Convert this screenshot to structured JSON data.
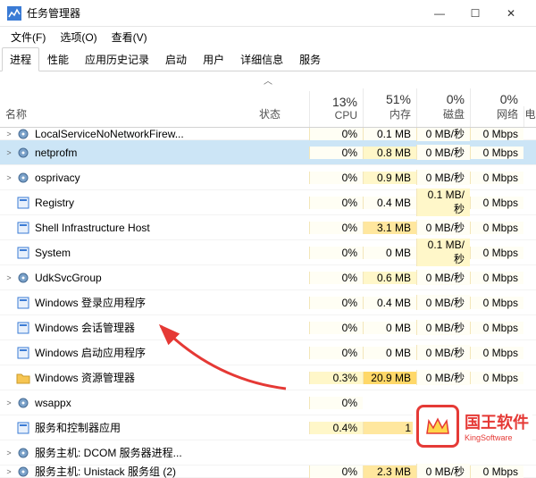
{
  "window": {
    "title": "任务管理器",
    "minimize": "—",
    "maximize": "☐",
    "close": "✕"
  },
  "menu": {
    "file": "文件(F)",
    "options": "选项(O)",
    "view": "查看(V)"
  },
  "tabs": [
    "进程",
    "性能",
    "应用历史记录",
    "启动",
    "用户",
    "详细信息",
    "服务"
  ],
  "collapse_hint": "︿",
  "columns": {
    "name": "名称",
    "status": "状态",
    "cpu_pct": "13%",
    "cpu_lbl": "CPU",
    "mem_pct": "51%",
    "mem_lbl": "内存",
    "disk_pct": "0%",
    "disk_lbl": "磁盘",
    "net_pct": "0%",
    "net_lbl": "网络",
    "extra": "电"
  },
  "rows": [
    {
      "exp": ">",
      "name": "LocalServiceNoNetworkFirew...",
      "cpu": "0%",
      "mem": "0.1 MB",
      "disk": "0 MB/秒",
      "net": "0 Mbps",
      "icon": "gear",
      "cut": true
    },
    {
      "exp": ">",
      "name": "netprofm",
      "cpu": "0%",
      "mem": "0.8 MB",
      "disk": "0 MB/秒",
      "net": "0 Mbps",
      "icon": "gear",
      "selected": true
    },
    {
      "exp": ">",
      "name": "osprivacy",
      "cpu": "0%",
      "mem": "0.9 MB",
      "disk": "0 MB/秒",
      "net": "0 Mbps",
      "icon": "gear"
    },
    {
      "exp": "",
      "name": "Registry",
      "cpu": "0%",
      "mem": "0.4 MB",
      "disk": "0.1 MB/秒",
      "net": "0 Mbps",
      "icon": "app"
    },
    {
      "exp": "",
      "name": "Shell Infrastructure Host",
      "cpu": "0%",
      "mem": "3.1 MB",
      "disk": "0 MB/秒",
      "net": "0 Mbps",
      "icon": "app"
    },
    {
      "exp": "",
      "name": "System",
      "cpu": "0%",
      "mem": "0 MB",
      "disk": "0.1 MB/秒",
      "net": "0 Mbps",
      "icon": "app"
    },
    {
      "exp": ">",
      "name": "UdkSvcGroup",
      "cpu": "0%",
      "mem": "0.6 MB",
      "disk": "0 MB/秒",
      "net": "0 Mbps",
      "icon": "gear"
    },
    {
      "exp": "",
      "name": "Windows 登录应用程序",
      "cpu": "0%",
      "mem": "0.4 MB",
      "disk": "0 MB/秒",
      "net": "0 Mbps",
      "icon": "app"
    },
    {
      "exp": "",
      "name": "Windows 会话管理器",
      "cpu": "0%",
      "mem": "0 MB",
      "disk": "0 MB/秒",
      "net": "0 Mbps",
      "icon": "app"
    },
    {
      "exp": "",
      "name": "Windows 启动应用程序",
      "cpu": "0%",
      "mem": "0 MB",
      "disk": "0 MB/秒",
      "net": "0 Mbps",
      "icon": "app"
    },
    {
      "exp": "",
      "name": "Windows 资源管理器",
      "cpu": "0.3%",
      "mem": "20.9 MB",
      "disk": "0 MB/秒",
      "net": "0 Mbps",
      "icon": "folder"
    },
    {
      "exp": ">",
      "name": "wsappx",
      "cpu": "0%",
      "mem": "",
      "disk": "",
      "net": "",
      "icon": "gear"
    },
    {
      "exp": "",
      "name": "服务和控制器应用",
      "cpu": "0.4%",
      "mem": "1",
      "disk": "",
      "net": "",
      "icon": "app"
    },
    {
      "exp": ">",
      "name": "服务主机: DCOM 服务器进程...",
      "cpu": "",
      "mem": "",
      "disk": "",
      "net": "",
      "icon": "gear"
    },
    {
      "exp": ">",
      "name": "服务主机: Unistack 服务组 (2)",
      "cpu": "0%",
      "mem": "2.3 MB",
      "disk": "0 MB/秒",
      "net": "0 Mbps",
      "icon": "gear",
      "cut": true
    }
  ],
  "watermark": {
    "cn": "国王软件",
    "en": "KingSoftware"
  }
}
